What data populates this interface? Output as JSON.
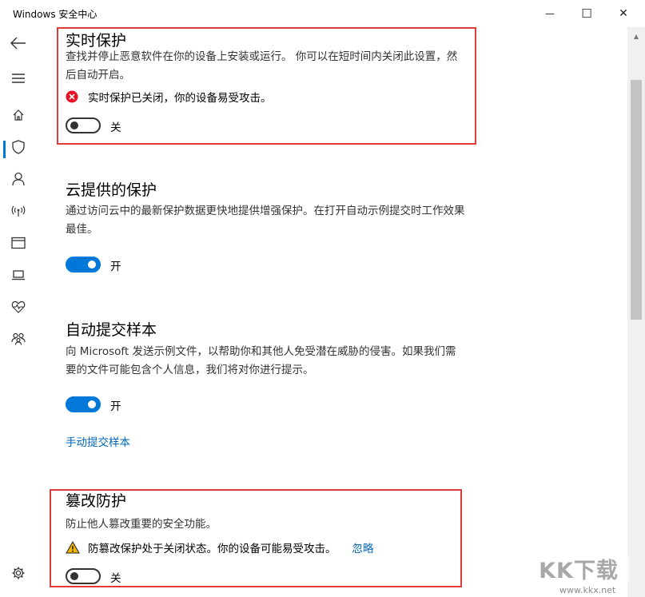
{
  "window": {
    "title": "Windows 安全中心",
    "minimize": "—",
    "maximize": "☐",
    "close": "✕"
  },
  "sidebar": {
    "items": [
      {
        "icon": "back-arrow-icon"
      },
      {
        "icon": "hamburger-menu-icon"
      },
      {
        "icon": "home-icon"
      },
      {
        "icon": "shield-icon",
        "selected": true
      },
      {
        "icon": "person-icon"
      },
      {
        "icon": "wifi-antenna-icon"
      },
      {
        "icon": "app-browser-icon"
      },
      {
        "icon": "laptop-icon"
      },
      {
        "icon": "heart-pulse-icon"
      },
      {
        "icon": "family-icon"
      },
      {
        "icon": "settings-gear-icon"
      }
    ]
  },
  "sections": {
    "realtime": {
      "title": "实时保护",
      "desc": "查找并停止恶意软件在你的设备上安装或运行。 你可以在短时间内关闭此设置，然后自动开启。",
      "status": "实时保护已关闭，你的设备易受攻击。",
      "toggle_state": "off",
      "toggle_label": "关"
    },
    "cloud": {
      "title": "云提供的保护",
      "desc": "通过访问云中的最新保护数据更快地提供增强保护。在打开自动示例提交时工作效果最佳。",
      "toggle_state": "on",
      "toggle_label": "开"
    },
    "sample": {
      "title": "自动提交样本",
      "desc": "向 Microsoft 发送示例文件，以帮助你和其他人免受潜在威胁的侵害。如果我们需要的文件可能包含个人信息，我们将对你进行提示。",
      "toggle_state": "on",
      "toggle_label": "开",
      "link": "手动提交样本"
    },
    "tamper": {
      "title": "篡改防护",
      "desc": "防止他人篡改重要的安全功能。",
      "status": "防篡改保护处于关闭状态。你的设备可能易受攻击。",
      "link": "忽略",
      "toggle_state": "off",
      "toggle_label": "关"
    }
  },
  "watermark": {
    "logo": "KK下载",
    "url": "www.kkx.net"
  },
  "colors": {
    "accent": "#0078d7",
    "error": "#e81123",
    "warning": "#f0b400",
    "highlight_box": "#e03c3c",
    "link": "#0067b8"
  }
}
